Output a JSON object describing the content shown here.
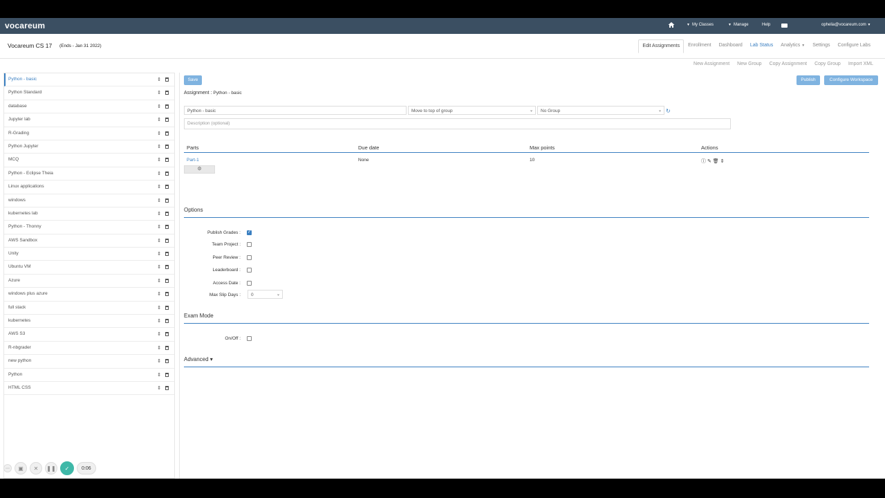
{
  "topnav": {
    "logo": "vocareum",
    "my_classes": "My Classes",
    "manage": "Manage",
    "help": "Help",
    "user": "ophelia@vocareum.com"
  },
  "classbar": {
    "title": "Vocareum CS 17",
    "ends": "(Ends - Jan 31 2022)",
    "tabs": [
      "Edit Assignments",
      "Enrollment",
      "Dashboard",
      "Lab Status",
      "Analytics",
      "Settings",
      "Configure Labs"
    ]
  },
  "subbar": [
    "New Assignment",
    "New Group",
    "Copy Assignment",
    "Copy Group",
    "Import XML"
  ],
  "sidebar": {
    "items": [
      "Python - basic",
      "Python Standard",
      "database",
      "Jupyter lab",
      "R-Grading",
      "Python Jupyter",
      "MCQ",
      "Python - Eclipse Theia",
      "Linux applications",
      "windows",
      "kubernetes lab",
      "Python - Thonny",
      "AWS Sandbox",
      "Unity",
      "Ubuntu VM",
      "Azure",
      "windows plus azure",
      "full stack",
      "kubernetes",
      "AWS S3",
      "R-nbgrader",
      "new python",
      "Python",
      "HTML CSS"
    ]
  },
  "main": {
    "save": "Save",
    "publish": "Publish",
    "configure_workspace": "Configure Workspace",
    "assignment_label": "Assignment :",
    "assignment_name": "Python - basic",
    "name_value": "Python - basic",
    "move_value": "Move to top of group",
    "group_value": "No Group",
    "description_placeholder": "Description (optional)"
  },
  "parts": {
    "headers": [
      "Parts",
      "Due date",
      "Max points",
      "Actions"
    ],
    "rows": [
      {
        "name": "Part-1",
        "due": "None",
        "points": "10"
      }
    ],
    "add_icon": "⚙"
  },
  "options": {
    "title": "Options",
    "publish_grades": "Publish Grades :",
    "publish_grades_checked": true,
    "team_project": "Team Project :",
    "peer_review": "Peer Review :",
    "leaderboard": "Leaderboard :",
    "access_date": "Access Date :",
    "max_slip_days": "Max Slip Days :",
    "max_slip_days_value": "0"
  },
  "exam": {
    "title": "Exam Mode",
    "onoff": "On/Off :"
  },
  "advanced": {
    "title": "Advanced ▾"
  },
  "recorder": {
    "timer": "0:06"
  }
}
